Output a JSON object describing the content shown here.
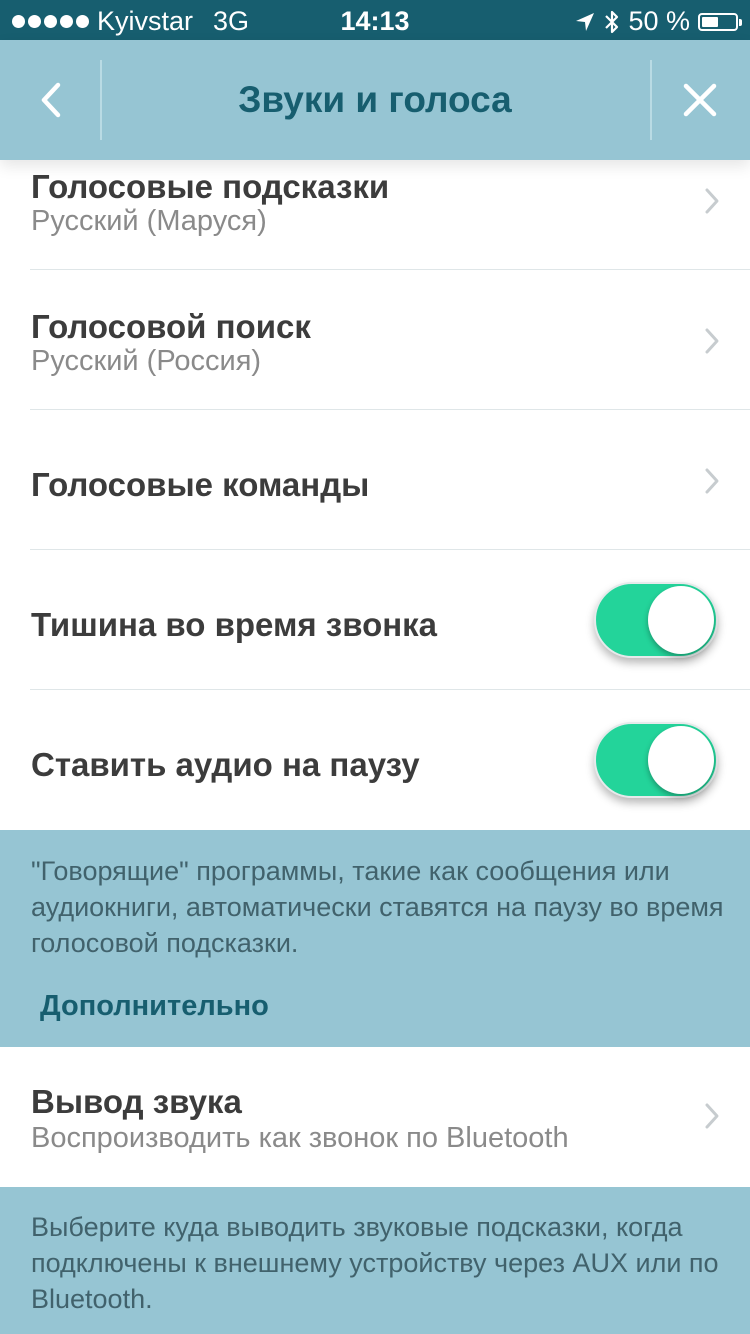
{
  "status": {
    "carrier": "Kyivstar",
    "network": "3G",
    "time": "14:13",
    "battery_text": "50 %",
    "battery_level": 0.5
  },
  "nav": {
    "title": "Звуки и голоса",
    "back_icon": "chevron-left-icon",
    "close_icon": "close-icon"
  },
  "rows": [
    {
      "title": "Голосовые подсказки",
      "subtitle": "Русский (Маруся)"
    },
    {
      "title": "Голосовой поиск",
      "subtitle": "Русский (Россия)"
    },
    {
      "title": "Голосовые команды"
    },
    {
      "title": "Тишина во время звонка",
      "toggle_on": true
    },
    {
      "title": "Ставить аудио на паузу",
      "toggle_on": true
    }
  ],
  "pause_note": "\"Говорящие\" программы, такие как сообщения или аудиокниги, автоматически ставятся на паузу во время голосовой подсказки.",
  "section_header": "Дополнительно",
  "output_row": {
    "title": "Вывод звука",
    "subtitle": "Воспроизводить как звонок по Bluetooth"
  },
  "output_note": "Выберите куда выводить звуковые подсказки, когда подключены к внешнему устройству через AUX или по Bluetooth.",
  "colors": {
    "accent": "#175e6f",
    "background": "#96c5d3",
    "toggle_on": "#23d49a"
  }
}
